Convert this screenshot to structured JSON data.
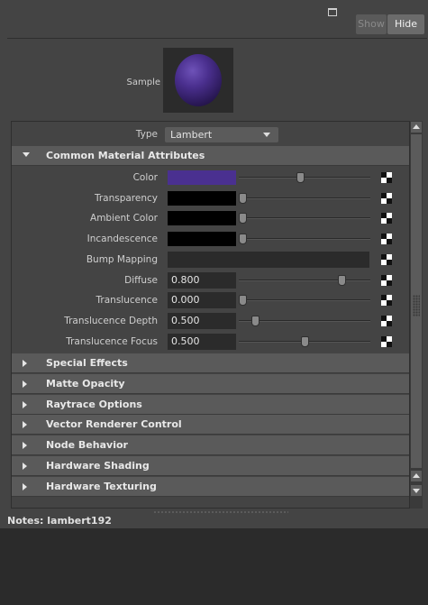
{
  "topbar": {
    "show_label": "Show",
    "hide_label": "Hide"
  },
  "sample": {
    "label": "Sample",
    "color": "#4a2f8e"
  },
  "type_row": {
    "label": "Type",
    "value": "Lambert"
  },
  "common": {
    "title": "Common Material Attributes",
    "attributes": [
      {
        "label": "Color",
        "swatch": "#4a3090",
        "slider": 0.47
      },
      {
        "label": "Transparency",
        "swatch": "#000000",
        "slider": 0.0
      },
      {
        "label": "Ambient Color",
        "swatch": "#000000",
        "slider": 0.0
      },
      {
        "label": "Incandescence",
        "swatch": "#000000",
        "slider": 0.0
      },
      {
        "label": "Bump Mapping"
      },
      {
        "label": "Diffuse",
        "value": "0.800",
        "slider": 0.8
      },
      {
        "label": "Translucence",
        "value": "0.000",
        "slider": 0.0
      },
      {
        "label": "Translucence Depth",
        "value": "0.500",
        "slider": 0.1
      },
      {
        "label": "Translucence Focus",
        "value": "0.500",
        "slider": 0.5
      }
    ]
  },
  "sections": [
    "Special Effects",
    "Matte Opacity",
    "Raytrace Options",
    "Vector Renderer Control",
    "Node Behavior",
    "Hardware Shading",
    "Hardware Texturing"
  ],
  "notes": {
    "label": "Notes:  lambert192"
  },
  "icons": {
    "popout": "popout-icon",
    "map": "checker-map-icon",
    "expand_open": "triangle-down-icon",
    "expand_closed": "triangle-right-icon"
  }
}
